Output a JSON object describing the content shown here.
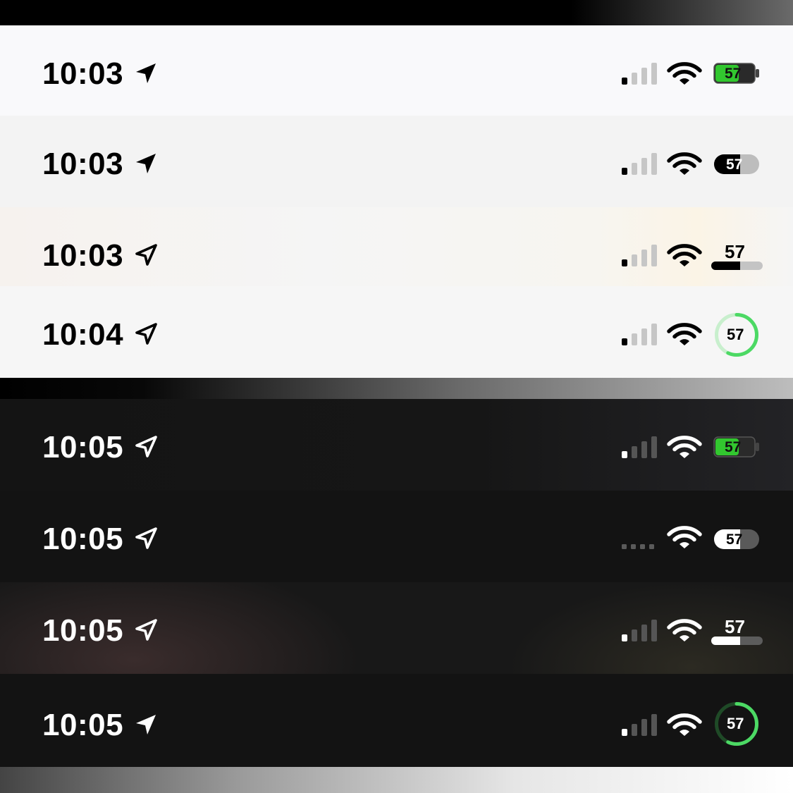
{
  "rows": [
    {
      "time": "10:03",
      "battery": "57"
    },
    {
      "time": "10:03",
      "battery": "57"
    },
    {
      "time": "10:03",
      "battery": "57"
    },
    {
      "time": "10:04",
      "battery": "57"
    },
    {
      "time": "10:05",
      "battery": "57"
    },
    {
      "time": "10:05",
      "battery": "57"
    },
    {
      "time": "10:05",
      "battery": "57"
    },
    {
      "time": "10:05",
      "battery": "57"
    }
  ],
  "battery_level_percent": 57,
  "colors": {
    "light_bg": "#f8f8fa",
    "dark_bg": "#151515",
    "battery_green": "#32c72f",
    "ring_green": "#4cd964"
  },
  "icons": [
    "location-arrow-icon",
    "cellular-signal-icon",
    "wifi-icon",
    "battery-icon"
  ]
}
